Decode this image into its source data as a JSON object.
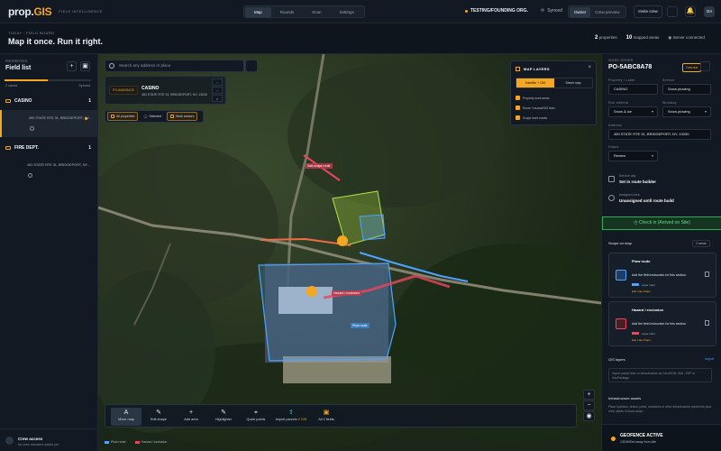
{
  "app": {
    "logo_main": "prop.",
    "logo_accent": "GIS",
    "tagline": "FIELD INTELLIGENCE"
  },
  "nav": {
    "tabs": [
      "Map",
      "Rounds",
      "Scan",
      "Settings"
    ],
    "active": "Map"
  },
  "org": {
    "name": "TESTING/FOUNDING ORG.",
    "sync": "Synced"
  },
  "roles": {
    "owner": "Owner",
    "preview": "Crew preview"
  },
  "invite": "Invite crew",
  "user": {
    "initials": "OA"
  },
  "page": {
    "crumb": "TODAY · FIELD BOARD",
    "title": "Map it once. Run it right."
  },
  "stats": {
    "properties_n": "2",
    "properties_l": "properties",
    "areas_n": "10",
    "areas_l": "mapped areas",
    "server": "Server connected"
  },
  "sidebar": {
    "label": "PROPERTIES",
    "title": "Field list",
    "meta_left": "2 saved",
    "meta_right": "Synced",
    "groups": [
      {
        "name": "CASINO",
        "count": "1",
        "item": "450 STATE RTE 31, BRIDGEPORT, NY..."
      },
      {
        "name": "FIRE DEPT.",
        "count": "1",
        "item": "451 STATE RTE 31, BRIDGEPORT, NY..."
      }
    ],
    "crew_title": "Crew access",
    "crew_sub": "No crew members added yet"
  },
  "map": {
    "search_placeholder": "Search any address or place",
    "card_code": "PO-5ABC8A78",
    "card_name": "CASINO",
    "card_addr": "450 STATE RTE 31, BRIDGEPORT, NY, 13030",
    "filters": [
      "All properties",
      "Selected",
      "Work sectors"
    ],
    "layers": {
      "title": "MAP LAYERS",
      "seg": [
        "Satellite + GIS",
        "Street map"
      ],
      "rows": [
        "Property work areas",
        "Route / hazard/GIS lines",
        "Scope work marks"
      ]
    },
    "labels": {
      "highlight": "Salt-scope route",
      "hazard": "Hazard / exclusion",
      "plow": "Plow route"
    },
    "tools": [
      "Move map",
      "Edit shape",
      "Add area",
      "Highlighter",
      "Quick points",
      "Import parcels",
      "All 2 fields"
    ],
    "tool_tag": "2 GIS",
    "legend": [
      "Plow route",
      "Hazard / exclusion"
    ],
    "zoom": [
      "+",
      "−",
      "◉"
    ]
  },
  "right": {
    "label": "WORK ORDER",
    "code": "PO-5ABC8A78",
    "badge": "Overdue",
    "f_prop_l": "Property / Label",
    "f_prop": "CASINO",
    "f_svc_l": "Service",
    "f_svc": "Snow plowing",
    "f_mode_l": "Run method",
    "f_mode": "Snow & ice",
    "f_sched_l": "Workday",
    "f_sched": "Snow plowing",
    "f_addr_l": "Address",
    "f_addr": "450 STATE RTE 31, BRIDGEPORT, NY, 13030",
    "f_status_l": "Status",
    "f_status": "Review",
    "svc_day_l": "Service day",
    "svc_day": "Set in route builder",
    "assign_l": "Assigned crew",
    "assign": "Unassigned until route build",
    "checkin": "Check in (Arrived on Site)",
    "scope_h": "Scope on map",
    "scope_c": "2 areas",
    "cards": [
      {
        "title": "Plow route",
        "desc": "Add the field instruction for this section",
        "sub": "Layer color",
        "edit": "Edit map shape"
      },
      {
        "title": "Hazard / exclusion",
        "desc": "Add the field instruction for this section",
        "sub": "Layer color",
        "edit": "Edit map shape"
      }
    ],
    "gis_h": "GIS layers",
    "gis_r": "Import",
    "gis_t": "Import parcel lines or infrastructure as GeoJSON, KML, SHP or GeoPackage.",
    "infra_h": "Infrastructure assets",
    "infra_t": "Place hydrants, drains, poles, manholes or other infrastructure points this plow crew needs to know about.",
    "geo1": "GEOFENCE ACTIVE",
    "geo2": "1304900m away from site"
  },
  "colors": {
    "accent": "#f5a623",
    "green": "#2fae5a",
    "plow": "#4fa3ff",
    "hazard": "#e8465b"
  }
}
